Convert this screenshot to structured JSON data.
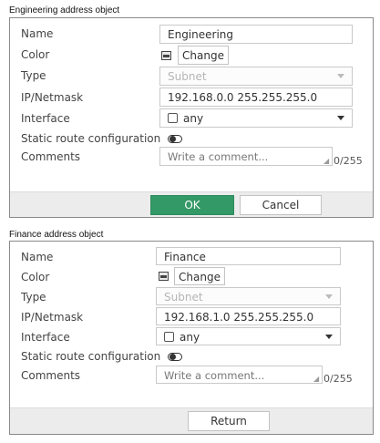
{
  "objects": [
    {
      "caption": "Engineering address object",
      "labels": {
        "name": "Name",
        "color": "Color",
        "type": "Type",
        "ipmask": "IP/Netmask",
        "interface": "Interface",
        "static_route": "Static route configuration",
        "comments": "Comments"
      },
      "values": {
        "name": "Engineering",
        "color_button": "Change",
        "type": "Subnet",
        "ipmask": "192.168.0.0 255.255.255.0",
        "interface": "any",
        "comment_placeholder": "Write a comment...",
        "comment_count": "0/255"
      },
      "buttons": {
        "ok": "OK",
        "cancel": "Cancel"
      }
    },
    {
      "caption": "Finance address object",
      "labels": {
        "name": "Name",
        "color": "Color",
        "type": "Type",
        "ipmask": "IP/Netmask",
        "interface": "Interface",
        "static_route": "Static route configuration",
        "comments": "Comments"
      },
      "values": {
        "name": "Finance",
        "color_button": "Change",
        "type": "Subnet",
        "ipmask": "192.168.1.0 255.255.255.0",
        "interface": "any",
        "comment_placeholder": "Write a comment...",
        "comment_count": "0/255"
      },
      "buttons": {
        "return": "Return"
      }
    }
  ],
  "colors": {
    "ok_button": "#339966",
    "footer": "#ececec"
  }
}
